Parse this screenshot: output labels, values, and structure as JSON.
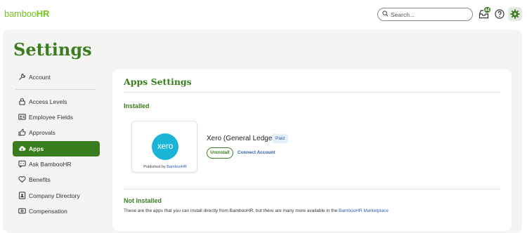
{
  "brand": {
    "logo_prefix": "bamboo",
    "logo_suffix": "HR",
    "color": "#73c41d"
  },
  "topbar": {
    "search_placeholder": "Search...",
    "inbox_count": "44",
    "icons": [
      "search-icon",
      "inbox-icon",
      "help-icon",
      "gear-icon"
    ]
  },
  "page": {
    "title": "Settings",
    "accent": "#3a7d1e"
  },
  "sidebar": {
    "items": [
      {
        "label": "Account",
        "icon": "wrench-icon"
      },
      {
        "label": "Access Levels",
        "icon": "lock-icon"
      },
      {
        "label": "Employee Fields",
        "icon": "id-card-icon"
      },
      {
        "label": "Approvals",
        "icon": "thumbs-up-icon"
      },
      {
        "label": "Apps",
        "icon": "cloud-icon",
        "active": true
      },
      {
        "label": "Ask BambooHR",
        "icon": "chat-icon"
      },
      {
        "label": "Benefits",
        "icon": "heart-icon"
      },
      {
        "label": "Company Directory",
        "icon": "directory-icon"
      },
      {
        "label": "Compensation",
        "icon": "money-icon"
      }
    ]
  },
  "main": {
    "title": "Apps Settings",
    "installed": {
      "heading": "Installed",
      "app": {
        "logo_text": "xero",
        "published_prefix": "Published by",
        "publisher": "BambooHR",
        "name": "Xero (General Ledger)",
        "badge": "Paid",
        "uninstall_label": "Uninstall",
        "connect_label": "Connect Account"
      }
    },
    "not_installed": {
      "heading": "Not Installed",
      "description_prefix": "These are the apps that you can install directly from BambooHR, but there are many more available in the",
      "marketplace_link": "BambooHR Marketplace"
    }
  }
}
